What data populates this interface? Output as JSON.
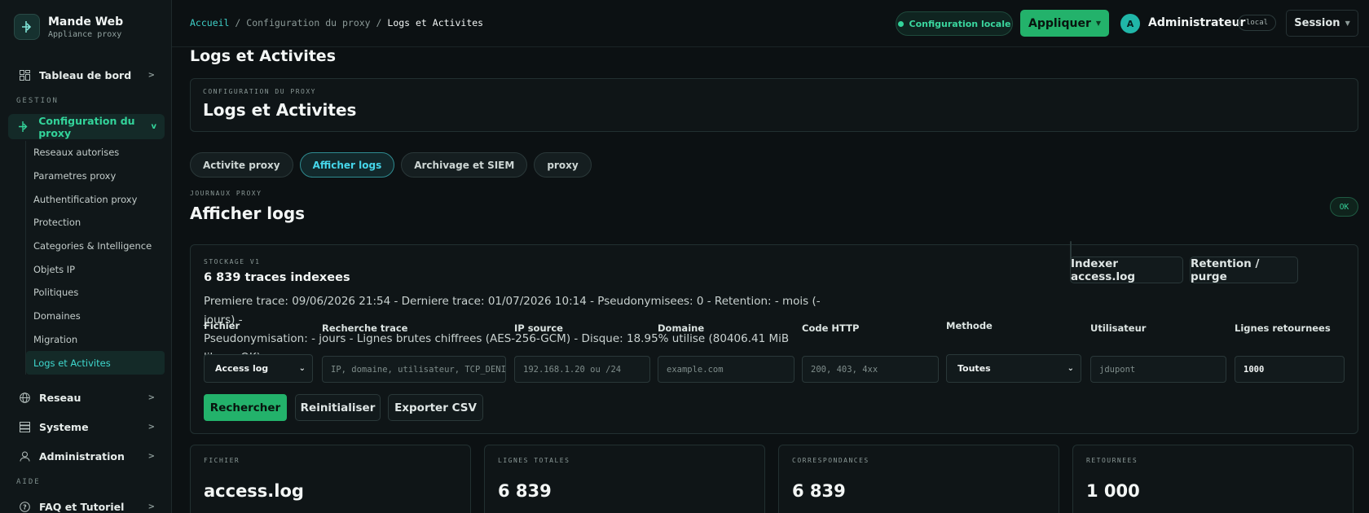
{
  "brand": {
    "title": "Mande Web",
    "subtitle": "Appliance proxy"
  },
  "sidebar": {
    "dashboard": "Tableau de bord",
    "section_gestion": "GESTION",
    "proxy_config": "Configuration du proxy",
    "sub_items": [
      "Reseaux autorises",
      "Parametres proxy",
      "Authentification proxy",
      "Protection",
      "Categories & Intelligence",
      "Objets IP",
      "Politiques",
      "Domaines",
      "Migration",
      "Logs et Activites"
    ],
    "reseau": "Reseau",
    "systeme": "Systeme",
    "administration": "Administration",
    "section_aide": "AIDE",
    "faq": "FAQ et Tutoriel"
  },
  "topbar": {
    "breadcrumb_home": "Accueil",
    "breadcrumb_mid": "Configuration du proxy",
    "breadcrumb_current": "Logs et Activites",
    "status": "Configuration locale",
    "apply": "Appliquer",
    "avatar_letter": "A",
    "user": "Administrateur",
    "user_tag": "local",
    "session": "Session"
  },
  "page": {
    "title": "Logs et Activites",
    "card_eyebrow": "CONFIGURATION DU PROXY",
    "card_title": "Logs et Activites"
  },
  "tabs": [
    "Activite proxy",
    "Afficher logs",
    "Archivage et SIEM",
    "proxy"
  ],
  "section": {
    "eyebrow": "JOURNAUX PROXY",
    "title": "Afficher logs",
    "badge": "OK"
  },
  "storage": {
    "eyebrow": "STOCKAGE V1",
    "count": "6 839 traces indexees",
    "desc_line1": "Premiere trace: 09/06/2026 21:54 - Derniere trace: 01/07/2026 10:14 - Pseudonymisees: 0 - Retention: - mois (- jours) -",
    "desc_line2": "Pseudonymisation: - jours - Lignes brutes chiffrees (AES-256-GCM) - Disque: 18.95% utilise (80406.41 MiB libres, OK).",
    "btn_index": "Indexer access.log",
    "btn_retention": "Retention / purge"
  },
  "filters": {
    "fichier_label": "Fichier",
    "fichier_value": "Access log",
    "trace_label": "Recherche trace",
    "trace_placeholder": "IP, domaine, utilisateur, TCP_DENIED",
    "ip_label": "IP source",
    "ip_placeholder": "192.168.1.20 ou /24",
    "domaine_label": "Domaine",
    "domaine_placeholder": "example.com",
    "http_label": "Code HTTP",
    "http_placeholder": "200, 403, 4xx",
    "methode_label": "Methode",
    "methode_value": "Toutes",
    "user_label": "Utilisateur",
    "user_placeholder": "jdupont",
    "lines_label": "Lignes retournees",
    "lines_value": "1000"
  },
  "actions": {
    "search": "Rechercher",
    "reset": "Reinitialiser",
    "export": "Exporter CSV"
  },
  "stats": [
    {
      "label": "FICHIER",
      "value": "access.log"
    },
    {
      "label": "LIGNES TOTALES",
      "value": "6 839"
    },
    {
      "label": "CORRESPONDANCES",
      "value": "6 839"
    },
    {
      "label": "RETOURNEES",
      "value": "1 000"
    }
  ]
}
